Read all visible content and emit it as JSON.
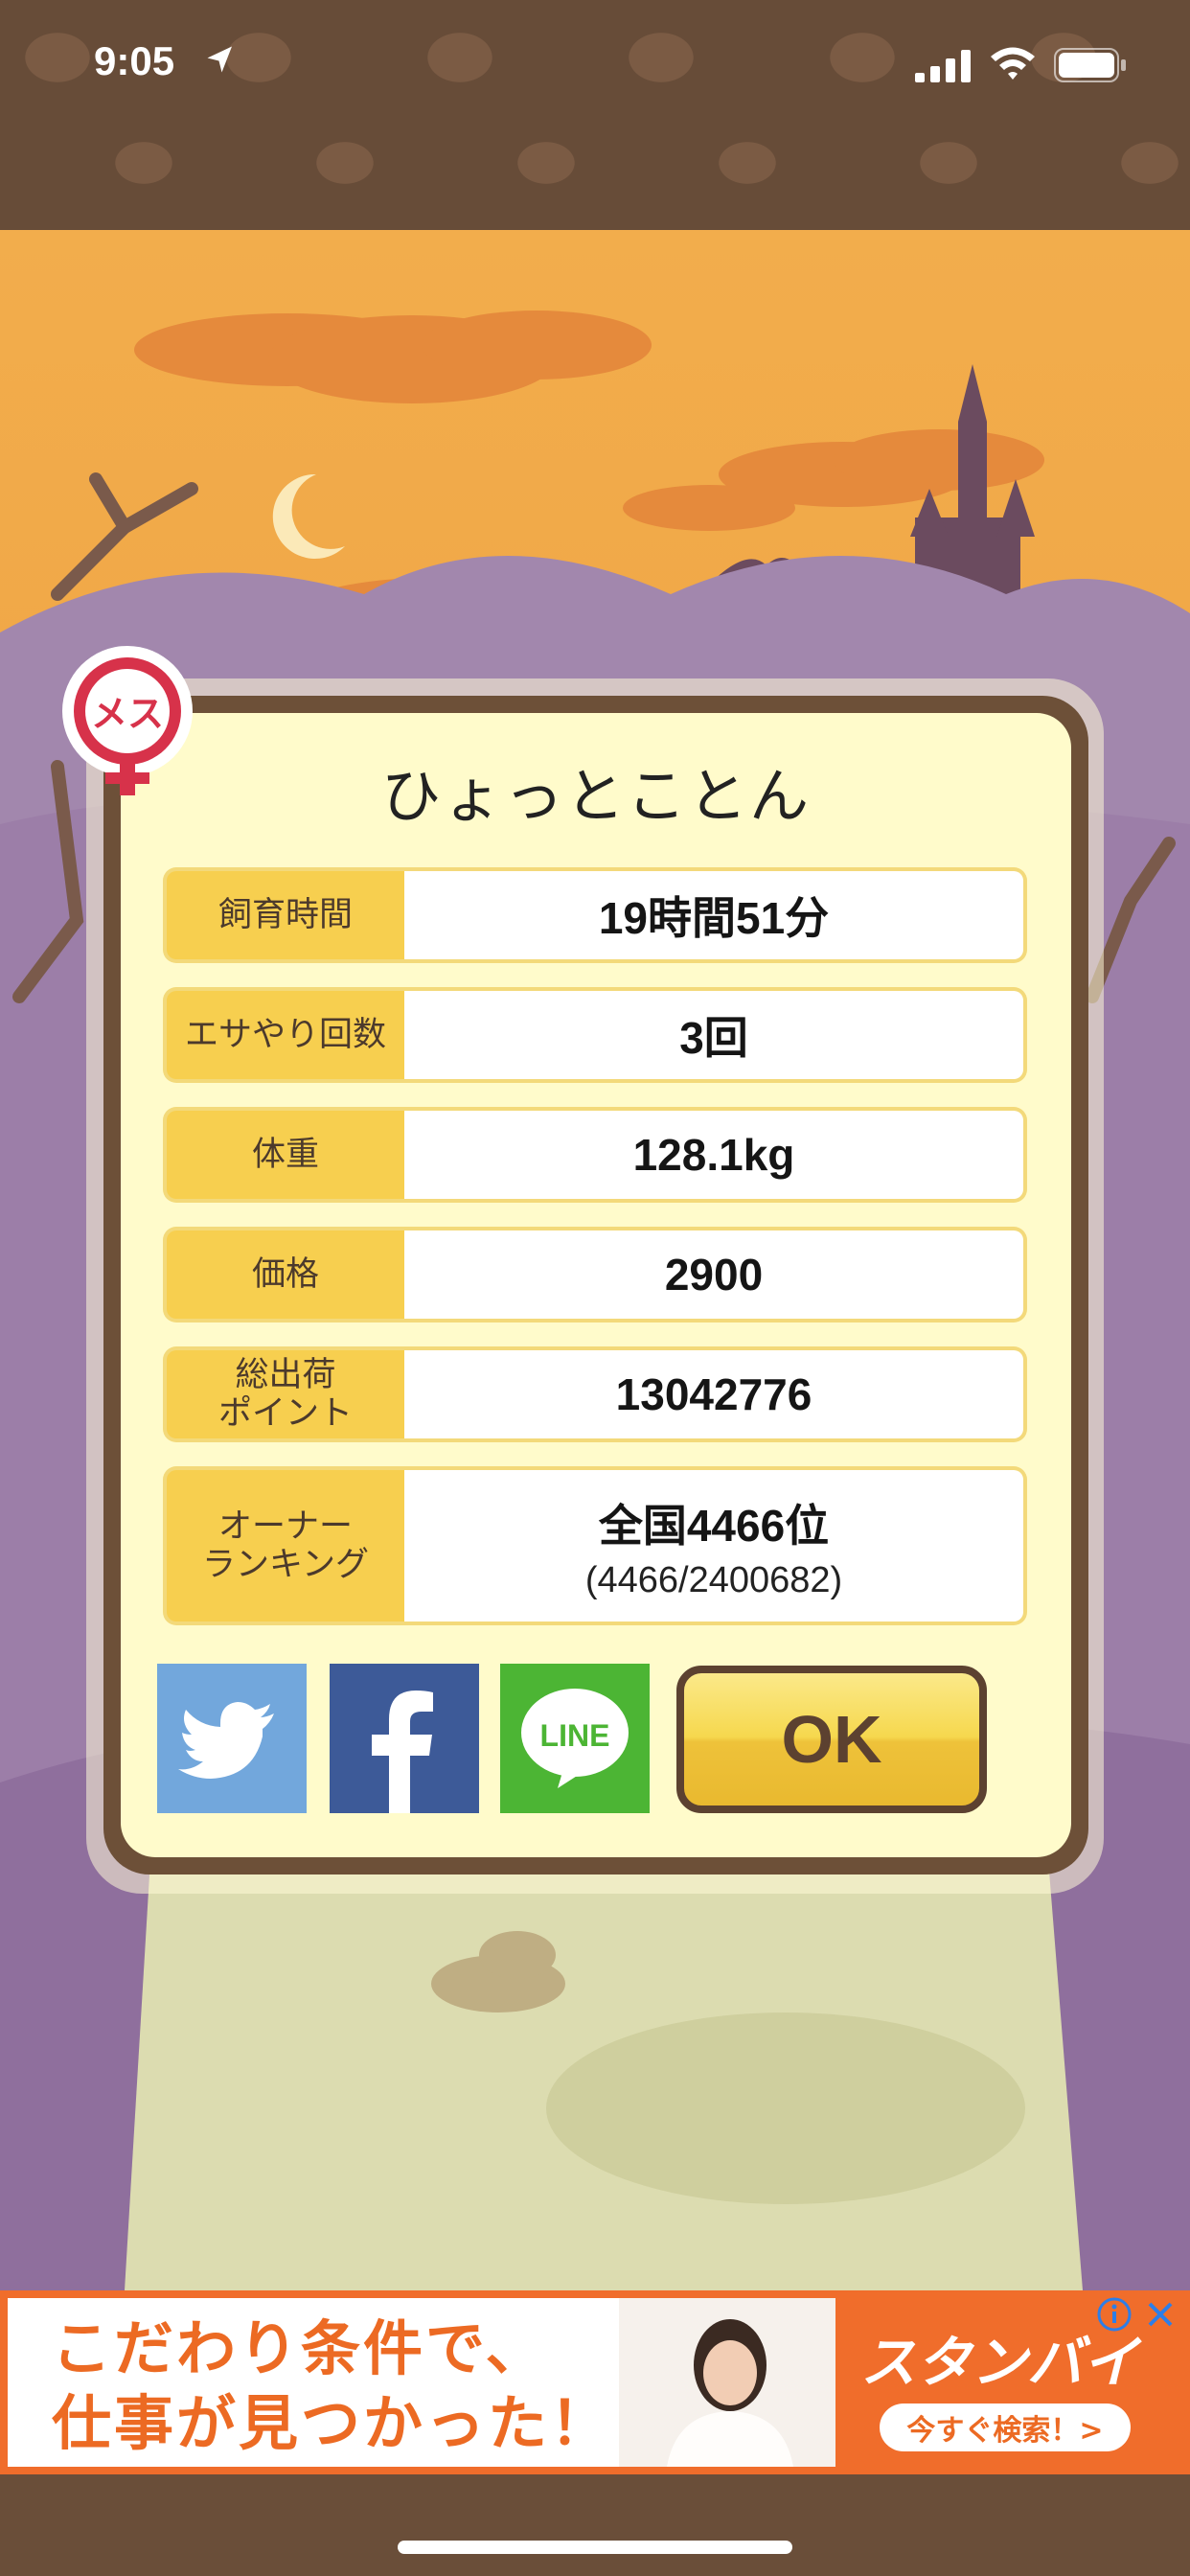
{
  "status_bar": {
    "time": "9:05"
  },
  "dialog": {
    "title": "ひょっとことん",
    "rows": [
      {
        "label": "飼育時間",
        "value": "19時間51分"
      },
      {
        "label": "エサやり回数",
        "value": "3回"
      },
      {
        "label": "体重",
        "value": "128.1kg"
      },
      {
        "label": "価格",
        "value": "2900"
      },
      {
        "label": "総出荷\nポイント",
        "value": "13042776"
      },
      {
        "label": "オーナー\nランキング",
        "value": "全国4466位",
        "sub": "(4466/2400682)"
      }
    ],
    "badge_text": "メス",
    "share": {
      "line_label": "LINE"
    },
    "ok_label": "OK"
  },
  "ad": {
    "headline_line1": "こだわり条件で、",
    "headline_line2": "仕事が見つかった！",
    "brand": "スタンバイ",
    "cta": "今すぐ検索！>"
  },
  "colors": {
    "sky": "#f0a646",
    "hills": "#9a7aa3",
    "dialog_bg": "#fffbcb",
    "dialog_border": "#6d5038",
    "label_bg": "#f7cf4f",
    "ad_orange": "#f06d2b",
    "badge_red": "#d7324a"
  }
}
